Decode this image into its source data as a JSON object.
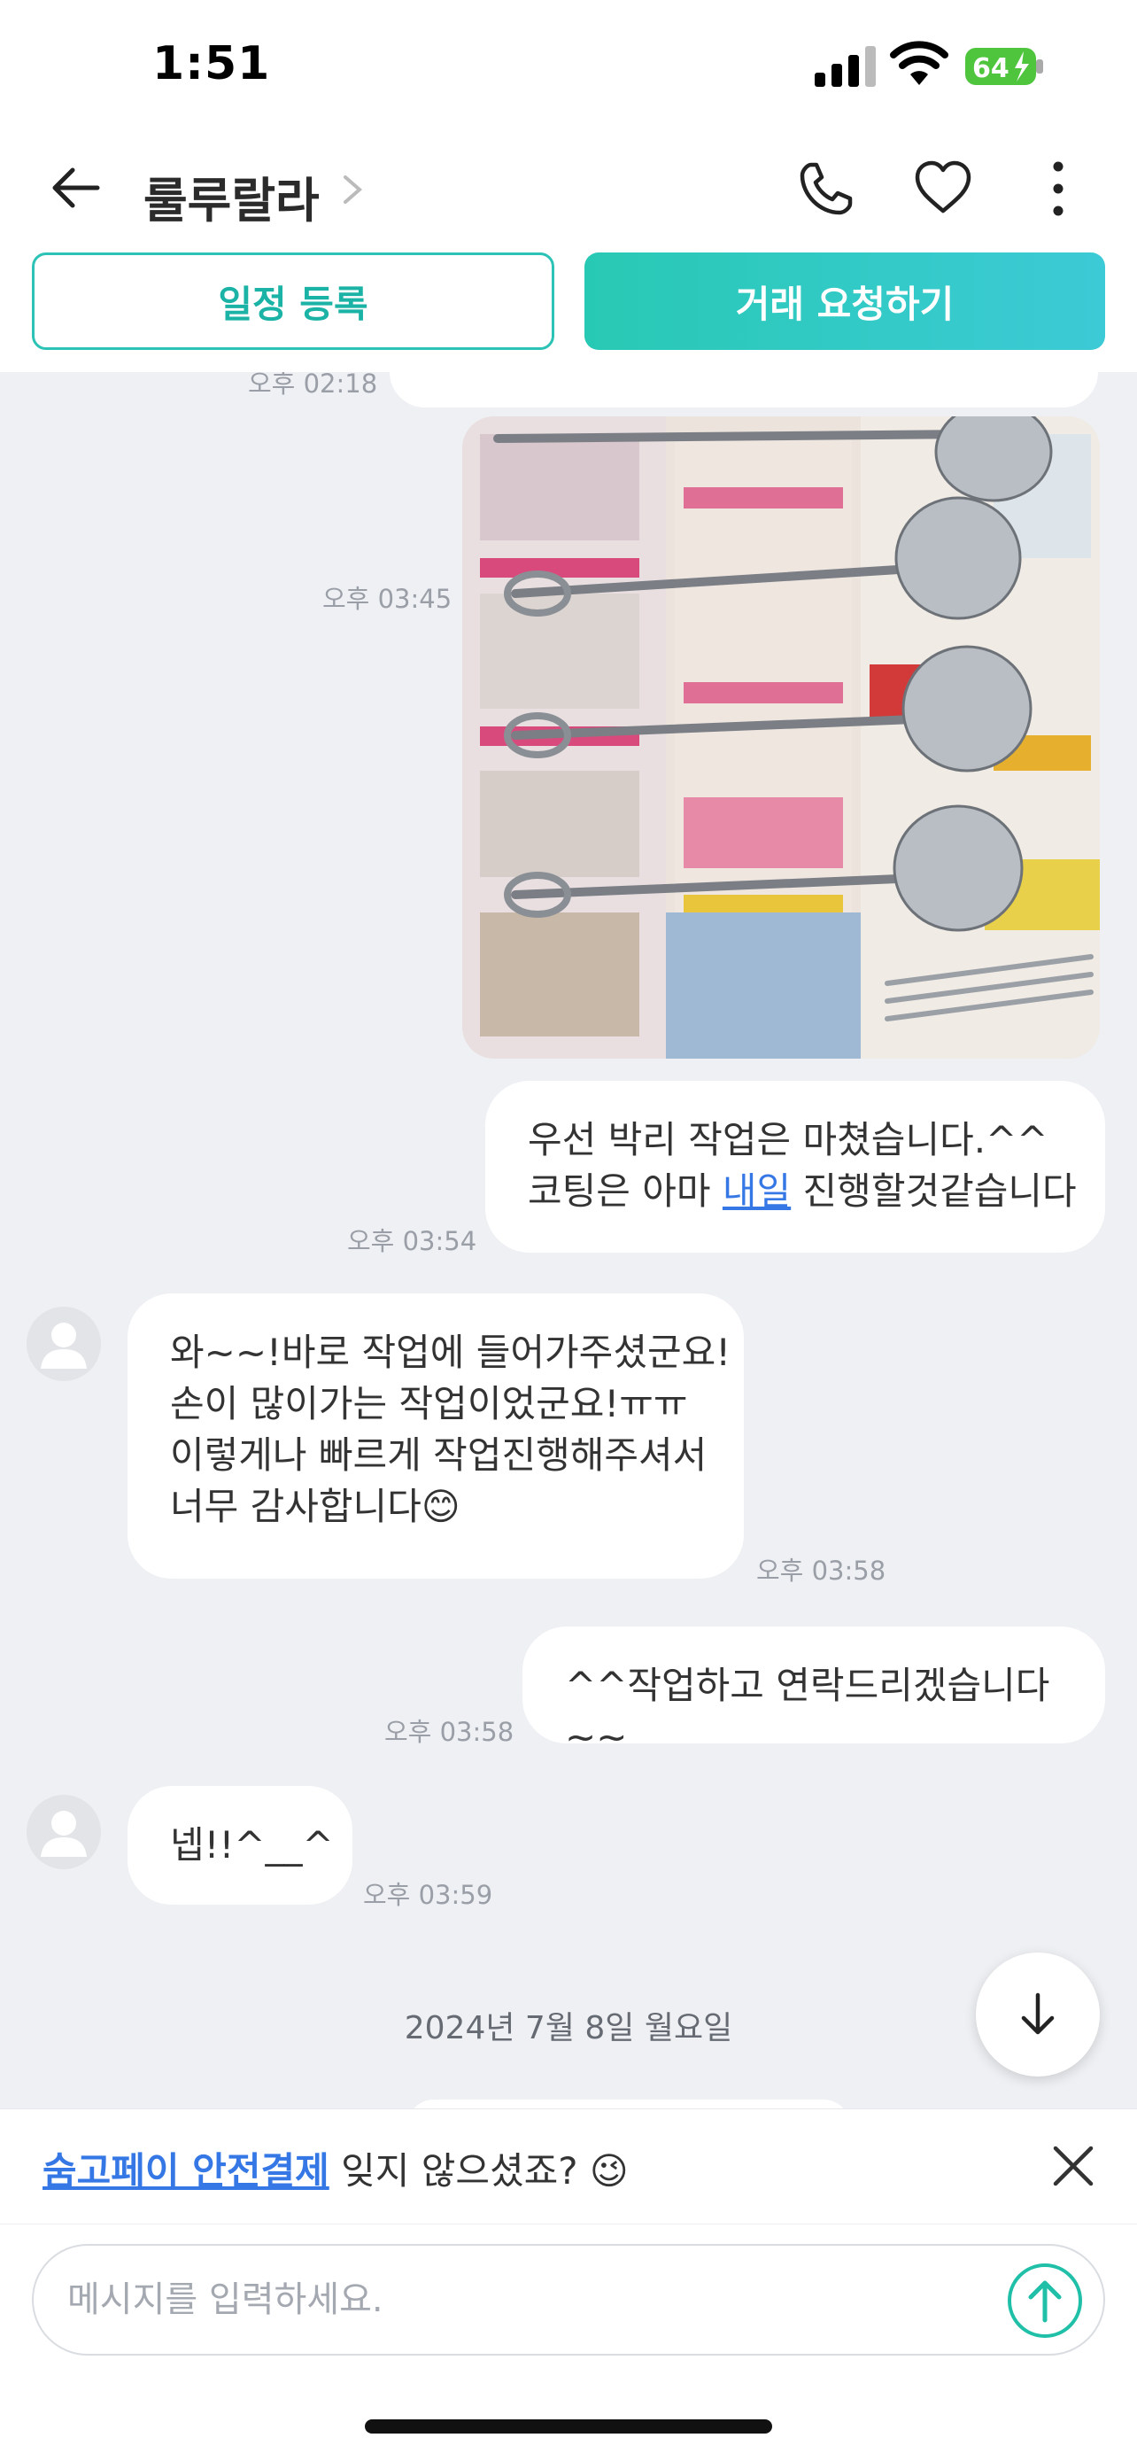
{
  "status_bar": {
    "time": "1:51",
    "battery": "64"
  },
  "header": {
    "title": "룰루랄라"
  },
  "actions": {
    "schedule_label": "일정 등록",
    "request_label": "거래 요청하기"
  },
  "messages": [
    {
      "time": "오후 02:18"
    },
    {
      "time": "오후 03:45"
    },
    {
      "line1": "우선 박리 작업은 마쳤습니다.^^",
      "line2_a": "코팅은 아마 ",
      "line2_link": "내일",
      "line2_b": " 진행할것같습니다",
      "time": "오후 03:54"
    },
    {
      "line1": "와~~!바로 작업에 들어가주셨군요!",
      "line2": "손이 많이가는 작업이었군요!ㅠㅠ",
      "line3": "이렇게나 빠르게 작업진행해주셔서",
      "line4": "너무 감사합니다😊",
      "time": "오후 03:58"
    },
    {
      "text": "^^작업하고 연락드리겠습니다~~",
      "time": "오후 03:58"
    },
    {
      "text": "넵!!^__^",
      "time": "오후 03:59"
    }
  ],
  "date_separator": "2024년 7월 8일 월요일",
  "notice": {
    "link": "숨고페이 안전결제",
    "text": " 잊지 않으셨죠? 😉"
  },
  "input": {
    "placeholder": "메시지를 입력하세요."
  },
  "colors": {
    "accent": "#2cc2b5",
    "link": "#3578e5",
    "chat_bg": "#eef0f4"
  }
}
